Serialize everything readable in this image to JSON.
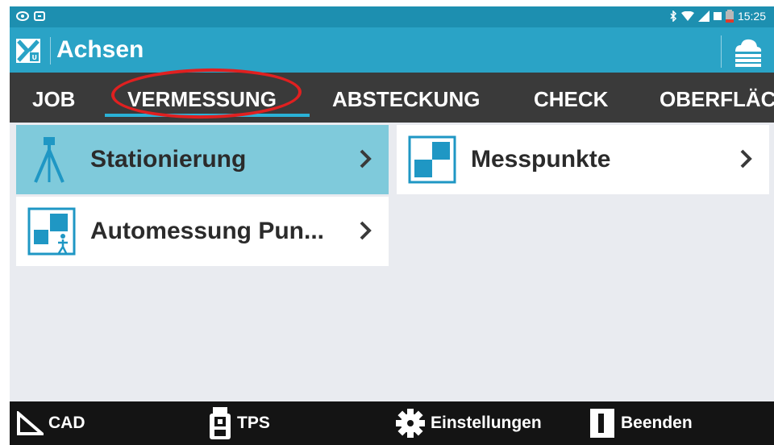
{
  "status_bar": {
    "time": "15:25"
  },
  "action_bar": {
    "title": "Achsen"
  },
  "tabs": [
    {
      "label": "JOB"
    },
    {
      "label": "VERMESSUNG"
    },
    {
      "label": "ABSTECKUNG"
    },
    {
      "label": "CHECK"
    },
    {
      "label": "OBERFLÄC"
    }
  ],
  "menu": {
    "items": [
      {
        "label": "Stationierung",
        "icon": "tripod-icon",
        "selected": true
      },
      {
        "label": "Messpunkte",
        "icon": "points-icon",
        "selected": false
      },
      {
        "label": "Automessung Pun...",
        "icon": "automeasure-icon",
        "selected": false
      }
    ]
  },
  "bottom_bar": {
    "cad": "CAD",
    "tps": "TPS",
    "settings": "Einstellungen",
    "exit": "Beenden"
  },
  "colors": {
    "status_bar": "#1d8fb0",
    "action_bar": "#2aa3c6",
    "tab_bar": "#3a3a3a",
    "tab_indicator": "#2ab1d6",
    "selected_tile": "#7fcadb",
    "icon_blue": "#1f97c4",
    "annotation": "#e02020",
    "bottom_bar": "#141414"
  }
}
